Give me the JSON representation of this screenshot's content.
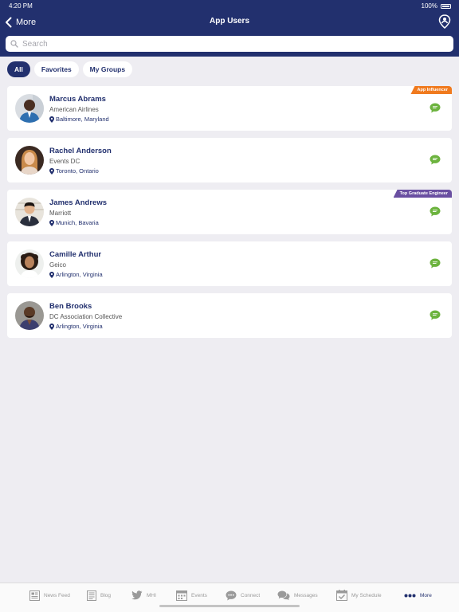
{
  "status": {
    "time": "4:20 PM",
    "battery": "100%"
  },
  "header": {
    "back_label": "More",
    "title": "App Users"
  },
  "search": {
    "placeholder": "Search",
    "value": ""
  },
  "filters": [
    {
      "label": "All",
      "active": true
    },
    {
      "label": "Favorites",
      "active": false
    },
    {
      "label": "My Groups",
      "active": false
    }
  ],
  "users": [
    {
      "name": "Marcus Abrams",
      "org": "American Airlines",
      "location": "Baltimore, Maryland",
      "badge": "App Influencer",
      "badge_color": "#f07a1e"
    },
    {
      "name": "Rachel Anderson",
      "org": "Events DC",
      "location": "Toronto, Ontario",
      "badge": "",
      "badge_color": ""
    },
    {
      "name": "James Andrews",
      "org": "Marriott",
      "location": "Munich, Bavaria",
      "badge": "Top Graduate Engineer",
      "badge_color": "#6a4fa1"
    },
    {
      "name": "Camille Arthur",
      "org": "Geico",
      "location": "Arlington, Virginia",
      "badge": "",
      "badge_color": ""
    },
    {
      "name": "Ben Brooks",
      "org": "DC Association Collective",
      "location": "Arlington, Virginia",
      "badge": "",
      "badge_color": ""
    }
  ],
  "tabbar": {
    "items": [
      {
        "label": "News Feed",
        "icon": "newspaper-icon"
      },
      {
        "label": "Blog",
        "icon": "blog-icon"
      },
      {
        "label": "MHI",
        "icon": "twitter-icon"
      },
      {
        "label": "Events",
        "icon": "calendar-icon"
      },
      {
        "label": "Connect",
        "icon": "chat-bubble-icon"
      },
      {
        "label": "Messages",
        "icon": "messages-icon"
      },
      {
        "label": "My Schedule",
        "icon": "calendar-check-icon"
      },
      {
        "label": "More",
        "icon": "more-dots-icon"
      }
    ],
    "active": "More"
  },
  "colors": {
    "primary": "#22306e",
    "chat_green": "#6cb33e",
    "background": "#eeedf2"
  }
}
